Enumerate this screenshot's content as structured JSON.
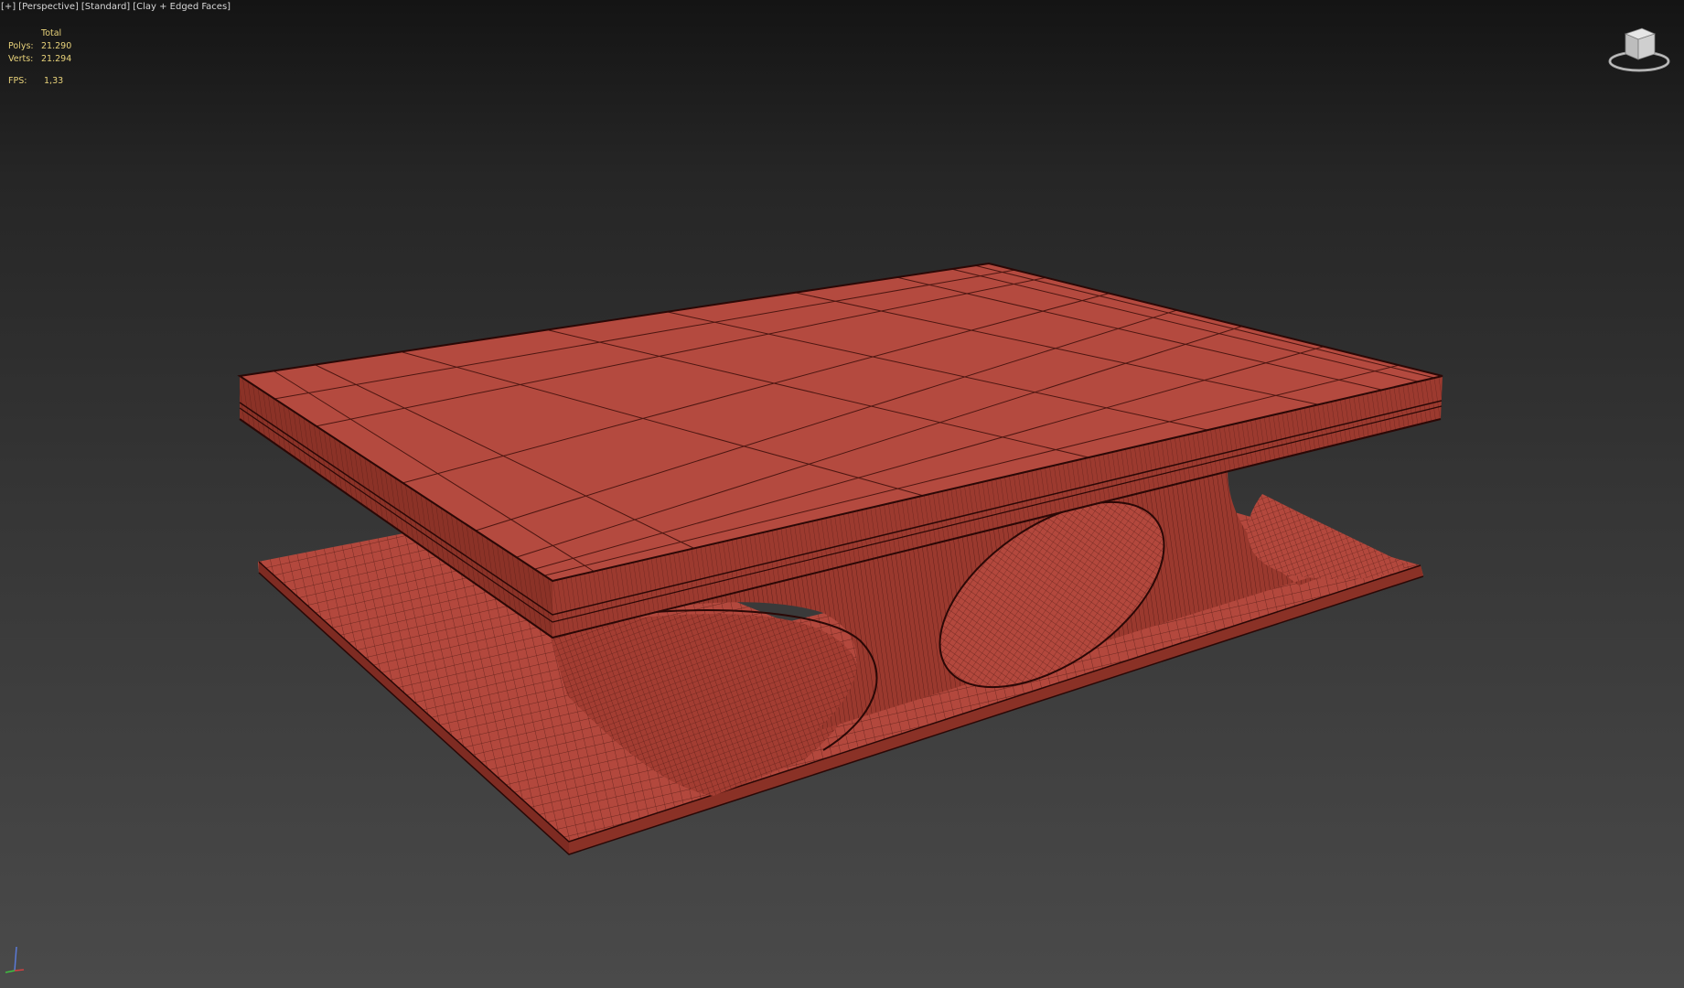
{
  "viewport": {
    "menu": "[+]",
    "view": "[Perspective]",
    "shading_preset": "[Standard]",
    "display_mode": "[Clay + Edged Faces]"
  },
  "stats": {
    "header": "Total",
    "polys_label": "Polys:",
    "polys_value": "21.290",
    "verts_label": "Verts:",
    "verts_value": "21.294",
    "fps_label": "FPS:",
    "fps_value": "1,33"
  },
  "icons": {
    "viewcube": "viewcube-icon",
    "axis": "axis-tripod-icon"
  },
  "colors": {
    "clay": "#b3483d",
    "clay_side": "#8f3429",
    "wire": "#3a0e0a",
    "stats_text": "#e8d27a",
    "label_text": "#d6d6d6"
  }
}
